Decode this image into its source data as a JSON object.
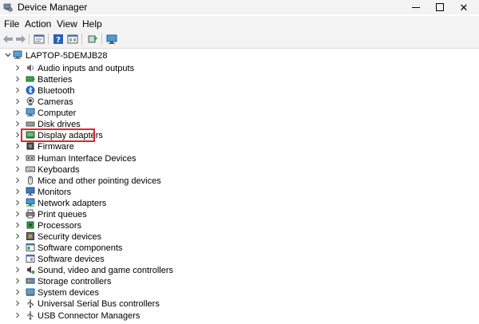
{
  "window": {
    "title": "Device Manager",
    "controls": {
      "minimize": "—",
      "maximize": "□",
      "close": "✕"
    }
  },
  "menu": {
    "items": [
      {
        "label": "File"
      },
      {
        "label": "Action"
      },
      {
        "label": "View"
      },
      {
        "label": "Help"
      }
    ]
  },
  "toolbar": {
    "buttons": [
      {
        "icon": "back-arrow-icon"
      },
      {
        "icon": "forward-arrow-icon"
      },
      {
        "icon": "properties-icon"
      },
      {
        "icon": "help-icon"
      },
      {
        "icon": "view-icon"
      },
      {
        "icon": "update-driver-icon"
      },
      {
        "icon": "monitor-scan-icon"
      }
    ]
  },
  "tree": {
    "root": {
      "label": "LAPTOP-5DEMJB28",
      "icon": "computer-icon",
      "expanded": true
    },
    "items": [
      {
        "label": "Audio inputs and outputs",
        "icon": "speaker-icon"
      },
      {
        "label": "Batteries",
        "icon": "battery-icon"
      },
      {
        "label": "Bluetooth",
        "icon": "bluetooth-icon"
      },
      {
        "label": "Cameras",
        "icon": "camera-icon"
      },
      {
        "label": "Computer",
        "icon": "computer-icon"
      },
      {
        "label": "Disk drives",
        "icon": "disk-drive-icon"
      },
      {
        "label": "Display adapters",
        "icon": "display-adapter-icon",
        "highlighted": true
      },
      {
        "label": "Firmware",
        "icon": "firmware-icon"
      },
      {
        "label": "Human Interface Devices",
        "icon": "hid-icon"
      },
      {
        "label": "Keyboards",
        "icon": "keyboard-icon"
      },
      {
        "label": "Mice and other pointing devices",
        "icon": "mouse-icon"
      },
      {
        "label": "Monitors",
        "icon": "monitor-icon"
      },
      {
        "label": "Network adapters",
        "icon": "network-adapter-icon"
      },
      {
        "label": "Print queues",
        "icon": "printer-icon"
      },
      {
        "label": "Processors",
        "icon": "processor-icon"
      },
      {
        "label": "Security devices",
        "icon": "security-icon"
      },
      {
        "label": "Software components",
        "icon": "software-component-icon"
      },
      {
        "label": "Software devices",
        "icon": "software-device-icon"
      },
      {
        "label": "Sound, video and game controllers",
        "icon": "sound-icon"
      },
      {
        "label": "Storage controllers",
        "icon": "storage-icon"
      },
      {
        "label": "System devices",
        "icon": "system-device-icon"
      },
      {
        "label": "Universal Serial Bus controllers",
        "icon": "usb-icon"
      },
      {
        "label": "USB Connector Managers",
        "icon": "usb-connector-icon"
      }
    ]
  },
  "colors": {
    "highlight": "#e3242b",
    "chrome": "#f3f3f3"
  }
}
